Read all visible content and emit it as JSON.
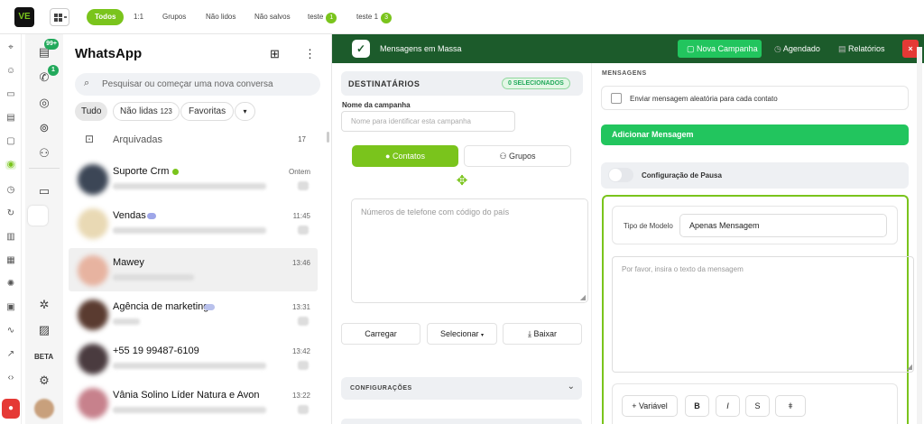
{
  "topbar": {
    "logo": "VE",
    "tabs": [
      {
        "label": "Todos",
        "count": ""
      },
      {
        "label": "1:1",
        "count": ""
      },
      {
        "label": "Grupos",
        "count": ""
      },
      {
        "label": "Não lidos",
        "count": ""
      },
      {
        "label": "Não salvos",
        "count": ""
      },
      {
        "label": "teste",
        "count": "1"
      },
      {
        "label": "teste 1",
        "count": "3"
      }
    ]
  },
  "rail": {
    "chats_badge": "99+",
    "calls_badge": "1",
    "beta_label": "BETA"
  },
  "whatsapp": {
    "title": "WhatsApp",
    "search_placeholder": "Pesquisar ou começar uma nova conversa",
    "filters": {
      "all": "Tudo",
      "unread": "Não lidas",
      "unread_count": "123",
      "favorites": "Favoritas"
    },
    "archived_label": "Arquivadas",
    "archived_count": "17",
    "chats": [
      {
        "name": "Suporte Crm",
        "time": "Ontem"
      },
      {
        "name": "Vendas",
        "time": "11:45"
      },
      {
        "name": "Mawey",
        "time": "13:46"
      },
      {
        "name": "Agência de marketing",
        "time": "13:31"
      },
      {
        "name": "+55 19 99487-6109",
        "time": "13:42"
      },
      {
        "name": "Vânia Solino Líder Natura e Avon",
        "time": "13:22"
      }
    ]
  },
  "campaign": {
    "title": "Mensagens em Massa",
    "nav": {
      "new": "Nova Campanha",
      "scheduled": "Agendado",
      "reports": "Relatórios",
      "close": "×"
    },
    "recipients": {
      "title": "DESTINATÁRIOS",
      "selected_badge": "0 SELECIONADOS",
      "campaign_name_label": "Nome da campanha",
      "campaign_name_placeholder": "Nome para identificar esta campanha",
      "tab_contacts": "Contatos",
      "tab_groups": "Grupos",
      "phones_placeholder": "Números de telefone com código do país",
      "load_button": "Carregar",
      "select_button": "Selecionar",
      "download_button": "Baixar"
    },
    "settings_label": "CONFIGURAÇÕES",
    "messages": {
      "title": "MENSAGENS",
      "random_checkbox_label": "Enviar mensagem aleatória para cada contato",
      "add_message_button": "Adicionar Mensagem",
      "pause_config_label": "Configuração de Pausa",
      "model_type_label": "Tipo de Modelo",
      "model_type_value": "Apenas Mensagem",
      "message_placeholder": "Por favor, insira o texto da mensagem",
      "variable_button": "+ Variável",
      "bold": "B",
      "italic": "I",
      "strike": "S",
      "mono": "ǂ"
    }
  },
  "colors": {
    "brand_green": "#7ac41c",
    "header_green": "#1c5b2b",
    "action_green": "#22c55e",
    "close_red": "#e53935"
  }
}
